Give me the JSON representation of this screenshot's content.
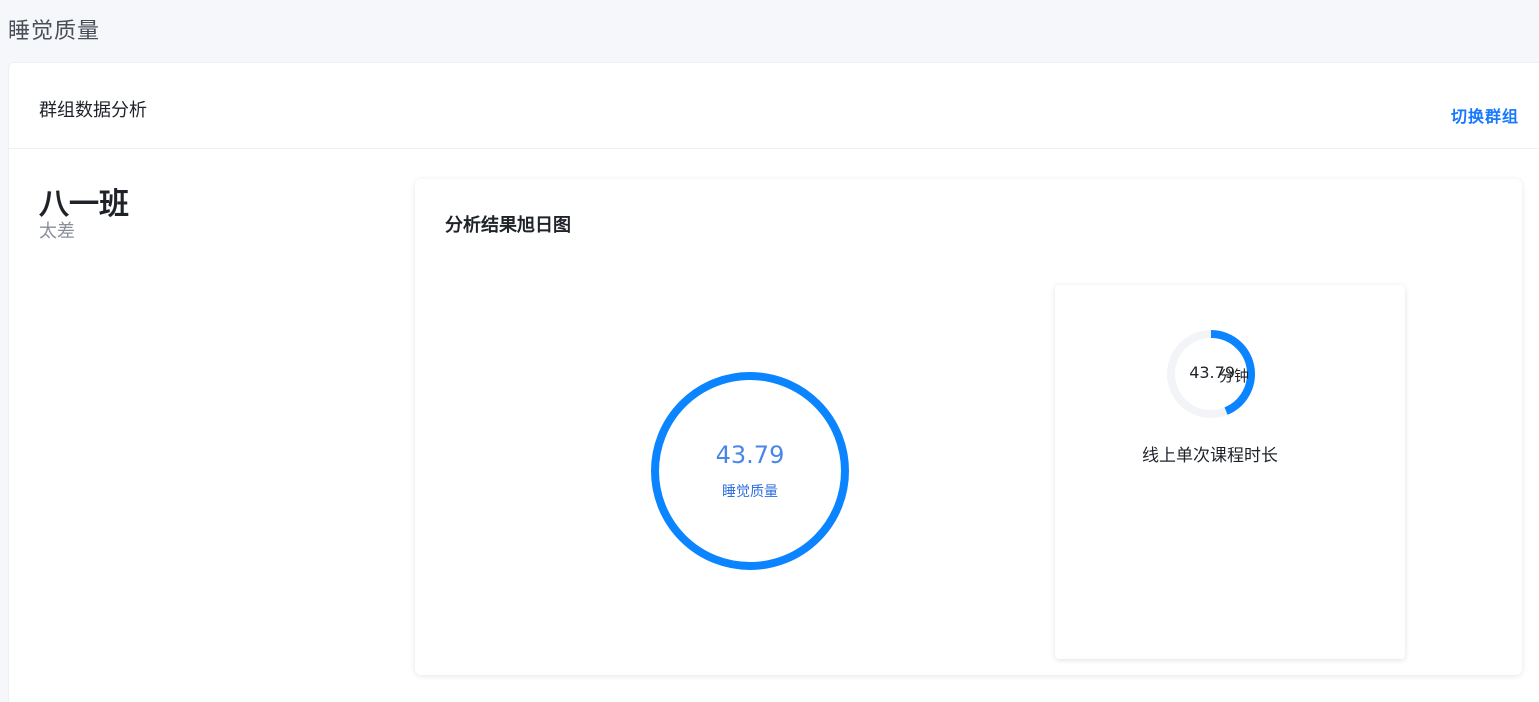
{
  "page": {
    "title": "睡觉质量"
  },
  "card": {
    "title": "群组数据分析",
    "switch_label": "切换群组"
  },
  "group": {
    "name": "八一班",
    "status": "太差"
  },
  "chart_panel": {
    "title": "分析结果旭日图"
  },
  "main_gauge": {
    "value": "43.79",
    "label": "睡觉质量",
    "progress_pct": 100,
    "color": "#0a84ff"
  },
  "secondary_gauge": {
    "value": "43.79",
    "unit": "分钟",
    "label": "线上单次课程时长",
    "progress_pct": 43.79,
    "color": "#0a84ff",
    "track_color": "#f2f4f7"
  }
}
